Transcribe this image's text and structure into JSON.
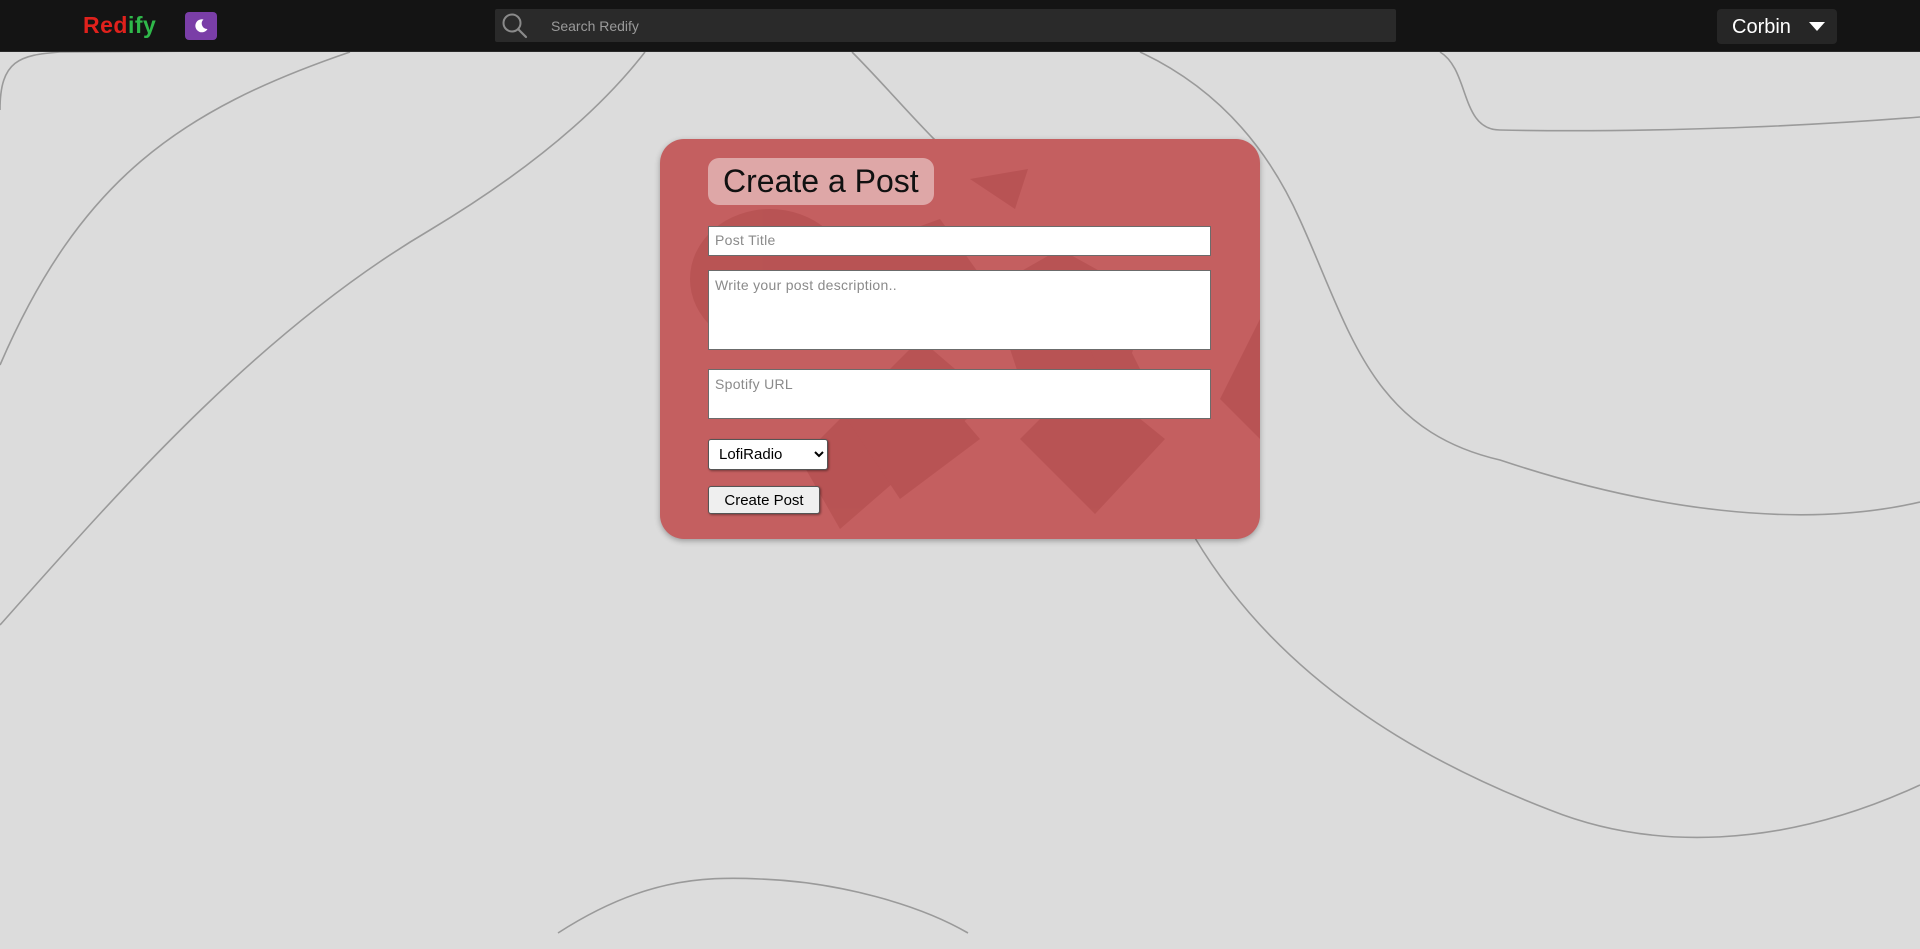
{
  "navbar": {
    "brand_part1": "Red",
    "brand_part2": "ify",
    "theme_icon": "moon-icon",
    "search_icon": "search-icon",
    "search_placeholder": "Search Redify",
    "user_name": "Corbin",
    "user_caret_icon": "caret-down-icon"
  },
  "form": {
    "heading": "Create a Post",
    "title_placeholder": "Post Title",
    "description_placeholder": "Write your post description..",
    "url_placeholder": "Spotify URL",
    "subreddit_selected": "LofiRadio",
    "submit_label": "Create Post"
  },
  "colors": {
    "brand_red": "#e0211c",
    "brand_green": "#2fb84a",
    "theme_toggle": "#7a3ea7",
    "navbar_bg": "#141414",
    "card_bg": "#c45f60",
    "page_bg": "#dcdcdc"
  }
}
